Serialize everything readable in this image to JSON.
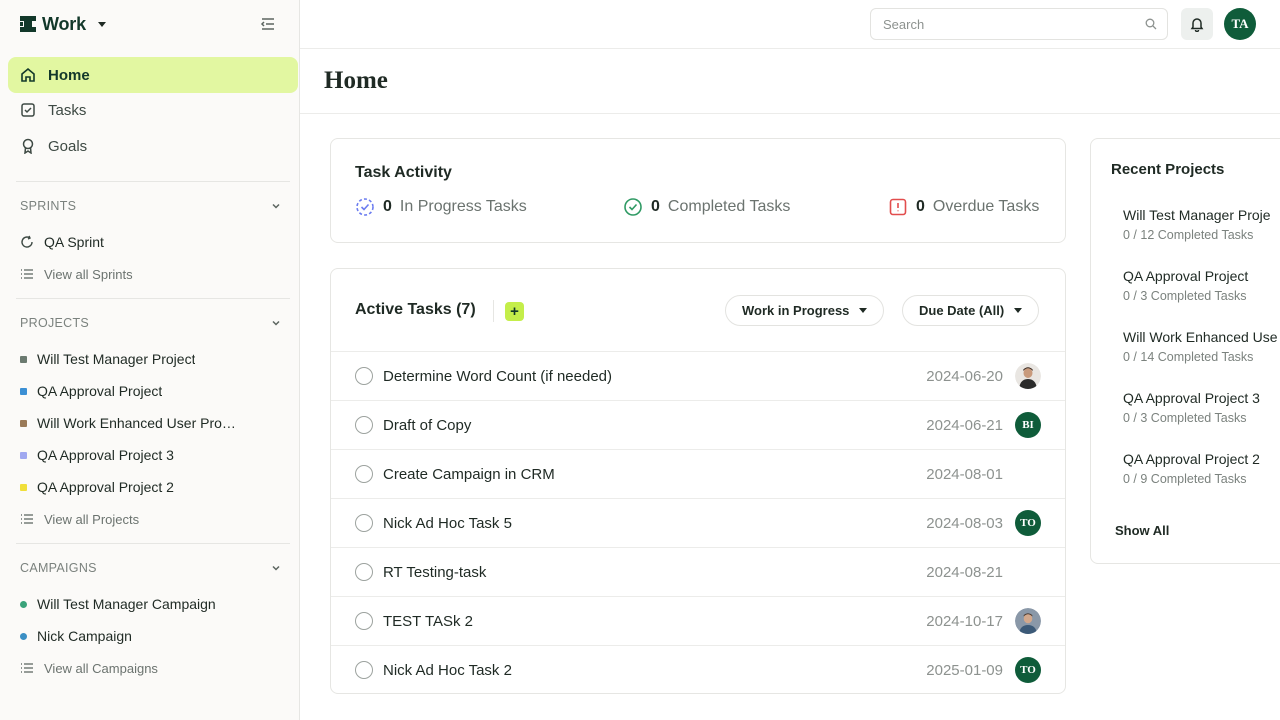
{
  "app": {
    "name": "Work"
  },
  "nav": {
    "home": "Home",
    "tasks": "Tasks",
    "goals": "Goals"
  },
  "sprints": {
    "header": "SPRINTS",
    "items": [
      {
        "label": "QA Sprint"
      }
    ],
    "view_all": "View all Sprints"
  },
  "projects": {
    "header": "PROJECTS",
    "items": [
      {
        "label": "Will Test Manager Project",
        "color": "#6b7a70"
      },
      {
        "label": "QA Approval Project",
        "color": "#3b8fd4"
      },
      {
        "label": "Will Work Enhanced User Proje...",
        "color": "#9a7a58"
      },
      {
        "label": "QA Approval Project 3",
        "color": "#a0a8f0"
      },
      {
        "label": "QA Approval Project 2",
        "color": "#f0df3a"
      }
    ],
    "view_all": "View all Projects"
  },
  "campaigns": {
    "header": "CAMPAIGNS",
    "items": [
      {
        "label": "Will Test Manager Campaign",
        "color": "#3aa37a"
      },
      {
        "label": "Nick Campaign",
        "color": "#3b8fc4"
      }
    ],
    "view_all": "View all Campaigns"
  },
  "topbar": {
    "search_placeholder": "Search",
    "user_initials": "TA"
  },
  "page": {
    "title": "Home"
  },
  "activity": {
    "title": "Task Activity",
    "in_progress": {
      "count": "0",
      "label": "In Progress Tasks"
    },
    "completed": {
      "count": "0",
      "label": "Completed Tasks"
    },
    "overdue": {
      "count": "0",
      "label": "Overdue Tasks"
    }
  },
  "active_tasks": {
    "title": "Active Tasks (7)",
    "add_label": "+",
    "filter_status": "Work in Progress",
    "filter_due": "Due Date (All)",
    "rows": [
      {
        "name": "Determine Word Count (if needed)",
        "date": "2024-06-20",
        "assignee": "photo-male"
      },
      {
        "name": "Draft of Copy",
        "date": "2024-06-21",
        "assignee": "BI"
      },
      {
        "name": "Create Campaign in CRM",
        "date": "2024-08-01",
        "assignee": ""
      },
      {
        "name": "Nick Ad Hoc Task 5",
        "date": "2024-08-03",
        "assignee": "TO"
      },
      {
        "name": "RT Testing-task",
        "date": "2024-08-21",
        "assignee": ""
      },
      {
        "name": "TEST TASk 2",
        "date": "2024-10-17",
        "assignee": "photo-male-2"
      },
      {
        "name": "Nick Ad Hoc Task 2",
        "date": "2025-01-09",
        "assignee": "TO"
      }
    ]
  },
  "recent_projects": {
    "title": "Recent Projects",
    "items": [
      {
        "name": "Will Test Manager Proje",
        "meta": "0 / 12 Completed Tasks"
      },
      {
        "name": "QA Approval Project",
        "meta": "0 / 3 Completed Tasks"
      },
      {
        "name": "Will Work Enhanced Use",
        "meta": "0 / 14 Completed Tasks"
      },
      {
        "name": "QA Approval Project 3",
        "meta": "0 / 3 Completed Tasks"
      },
      {
        "name": "QA Approval Project 2",
        "meta": "0 / 9 Completed Tasks"
      }
    ],
    "show_all": "Show All"
  },
  "colors": {
    "brand": "#12382a",
    "accent": "#c4ee4a",
    "nav_active_bg": "#e2f7a1",
    "avatar_bg": "#0f5c3a"
  }
}
